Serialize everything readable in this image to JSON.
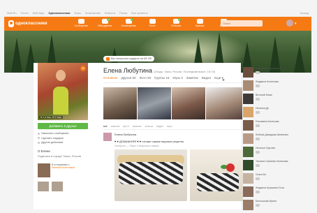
{
  "topbar": {
    "links": [
      "Mail.Ru",
      "Почта",
      "Мой Мир",
      "Одноклассники",
      "Игры",
      "Знакомства",
      "Новости",
      "Поиск",
      "Все проекты"
    ],
    "active_index": 3,
    "exit_label": "Выход"
  },
  "header": {
    "logo_text": "одноклассники",
    "nav": [
      {
        "icon": "envelope-icon",
        "label": "Сообщения",
        "badge": ""
      },
      {
        "icon": "discussions-icon",
        "label": "Обсуждения",
        "badge": "14"
      },
      {
        "icon": "bell-icon",
        "label": "Оповещения",
        "badge": "1"
      },
      {
        "icon": "guests-icon",
        "label": "Гости",
        "badge": ""
      },
      {
        "icon": "events-icon",
        "label": "События",
        "badge": "3"
      },
      {
        "icon": "music-icon",
        "label": "Музыка",
        "badge": ""
      },
      {
        "icon": "video-icon",
        "label": "Видео",
        "badge": ""
      }
    ],
    "search_placeholder": "Поиск"
  },
  "banner": {
    "gift_label": "Вы получили подарок на 45 ОК"
  },
  "profile": {
    "name": "Елена Любутина",
    "meta": "(Огадо, Омск, Россия, Последний визит: 19:19)",
    "badge": "56",
    "photo_stats": "♥ 1,4 тыс. ✉ 2 тыс.",
    "add_friend_label": "Добавить в друзья",
    "actions": [
      "Написать сообщение",
      "Сделать подарок",
      "Другие действия"
    ],
    "about_title": "О Елене",
    "about_line": "Родилась в городе Томск, Россия",
    "friend_note": "В отношениях с",
    "friend_name": "Евгений Колесников"
  },
  "tabs": {
    "items": [
      "Основное",
      "Друзья 60",
      "Фото 93",
      "Группы 16",
      "Игры 3",
      "Заметки",
      "Видео",
      "Ещё ▾"
    ],
    "active_index": 0
  },
  "subtabs": {
    "items": [
      "всё",
      "заметки",
      "фото",
      "заметки",
      "классы",
      "видео",
      "игры"
    ],
    "active_index": 0
  },
  "post": {
    "author": "Елена Любутина",
    "text": "♥ ♥ ДОМАШНЯЯ ♥ ♥ готовит самые вкусные рецепты",
    "sub": "Смотрите — Пирог с творогом и маком"
  },
  "friends": [
    {
      "name": "Маргарита Ворожеина"
    },
    {
      "name": "Людмила Кочеткова"
    },
    {
      "name": "Виталий Козак"
    },
    {
      "name": "Наталья Ду"
    },
    {
      "name": "Елизавета Колесова"
    },
    {
      "name": "Любовь Давыдова Шевченко"
    },
    {
      "name": "Наталья Трусова"
    },
    {
      "name": "Татьяна Сажнева Усленкова"
    },
    {
      "name": "Ольга Кв"
    },
    {
      "name": "Людмила Кузьмина Сочи"
    },
    {
      "name": "Бахтышова Ирина"
    }
  ],
  "colors": {
    "brand_orange": "#f57a14",
    "friend_button_green": "#60b946"
  }
}
